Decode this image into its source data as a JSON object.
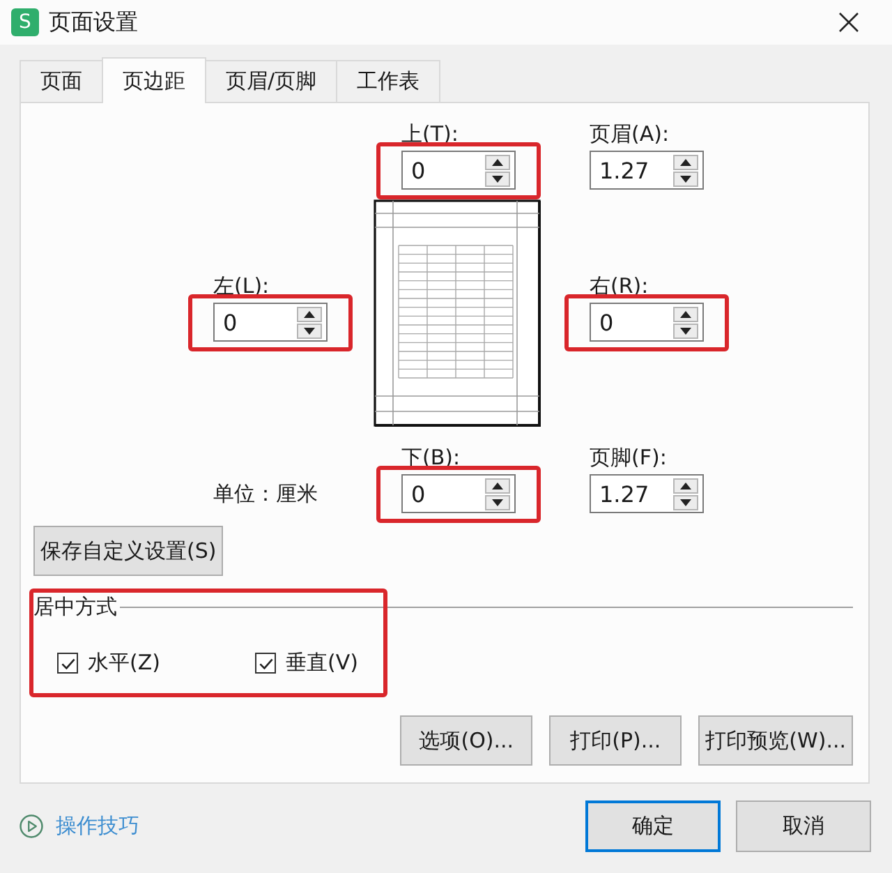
{
  "window": {
    "icon_letter": "S",
    "title": "页面设置"
  },
  "tabs": [
    {
      "label": "页面",
      "selected": false
    },
    {
      "label": "页边距",
      "selected": true
    },
    {
      "label": "页眉/页脚",
      "selected": false
    },
    {
      "label": "工作表",
      "selected": false
    }
  ],
  "margins": [
    {
      "label": "上(T):",
      "value": "0",
      "highlighted": true
    },
    {
      "label": "页眉(A):",
      "value": "1.27",
      "highlighted": false
    },
    {
      "label": "左(L):",
      "value": "0",
      "highlighted": true
    },
    {
      "label": "右(R):",
      "value": "0",
      "highlighted": true
    },
    {
      "label": "下(B):",
      "value": "0",
      "highlighted": true
    },
    {
      "label": "页脚(F):",
      "value": "1.27",
      "highlighted": false
    }
  ],
  "unit_label": "单位：厘米",
  "save_button": "保存自定义设置(S)",
  "centering": {
    "title": "居中方式",
    "highlighted": true,
    "options": [
      {
        "label": "水平(Z)",
        "checked": true
      },
      {
        "label": "垂直(V)",
        "checked": true
      }
    ]
  },
  "action_buttons": [
    "选项(O)...",
    "打印(P)...",
    "打印预览(W)..."
  ],
  "tips_link": "操作技巧",
  "footer_buttons": [
    {
      "label": "确定",
      "default": true
    },
    {
      "label": "取消",
      "default": false
    }
  ]
}
